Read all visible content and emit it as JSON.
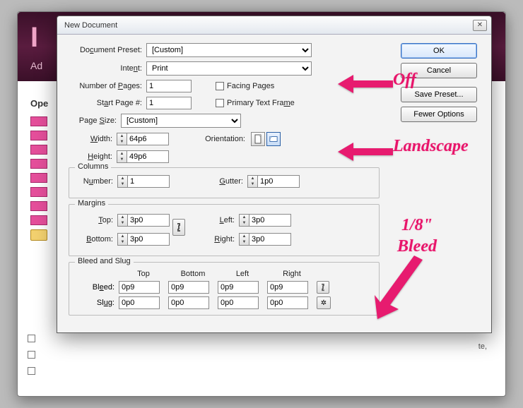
{
  "bg": {
    "logo_prefix": "I",
    "ado": "Ad",
    "ope": "Ope",
    "te": "te,"
  },
  "dialog": {
    "title": "New Document",
    "buttons": {
      "ok": "OK",
      "cancel": "Cancel",
      "save_preset": "Save Preset...",
      "fewer_options": "Fewer Options"
    },
    "labels": {
      "doc_preset": "Document Preset:",
      "intent": "Intent:",
      "num_pages": "Number of Pages:",
      "start_page": "Start Page #:",
      "facing_pages": "Facing Pages",
      "primary_text_frame": "Primary Text Frame",
      "page_size": "Page Size:",
      "width": "Width:",
      "height": "Height:",
      "orientation": "Orientation:",
      "columns": "Columns",
      "number": "Number:",
      "gutter": "Gutter:",
      "margins": "Margins",
      "top": "Top:",
      "bottom": "Bottom:",
      "left": "Left:",
      "right": "Right:",
      "bleed_slug": "Bleed and Slug",
      "bleed": "Bleed:",
      "slug": "Slug:",
      "col_top": "Top",
      "col_bottom": "Bottom",
      "col_left": "Left",
      "col_right": "Right"
    },
    "values": {
      "doc_preset": "[Custom]",
      "intent": "Print",
      "num_pages": "1",
      "start_page": "1",
      "facing_pages": false,
      "primary_text_frame": false,
      "page_size": "[Custom]",
      "width": "64p6",
      "height": "49p6",
      "orientation": "landscape",
      "columns_number": "1",
      "gutter": "1p0",
      "margin_top": "3p0",
      "margin_bottom": "3p0",
      "margin_left": "3p0",
      "margin_right": "3p0",
      "bleed": {
        "top": "0p9",
        "bottom": "0p9",
        "left": "0p9",
        "right": "0p9"
      },
      "slug": {
        "top": "0p0",
        "bottom": "0p0",
        "left": "0p0",
        "right": "0p0"
      }
    }
  },
  "annotations": {
    "off": "Off",
    "landscape": "Landscape",
    "bleed": "1/8\"",
    "bleed2": "Bleed"
  }
}
